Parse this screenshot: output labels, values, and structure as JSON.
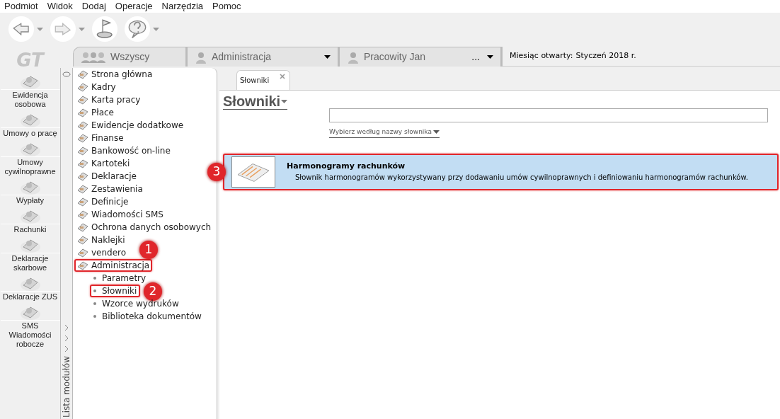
{
  "menu": [
    "Podmiot",
    "Widok",
    "Dodaj",
    "Operacje",
    "Narzędzia",
    "Pomoc"
  ],
  "toolbar": [
    {
      "kind": "back",
      "has_caret": true
    },
    {
      "kind": "forward",
      "has_caret": true
    },
    {
      "kind": "flag",
      "has_caret": false
    },
    {
      "kind": "help",
      "has_caret": true
    }
  ],
  "logo": "GT",
  "top_tabs": [
    {
      "label": "Wszyscy",
      "kind": "group"
    },
    {
      "label": "Administracja",
      "kind": "dropdown"
    },
    {
      "label": "Pracowity Jan",
      "kind": "person",
      "extra": "..."
    }
  ],
  "open_month": {
    "label": "Miesiąc otwarty:",
    "value": "Styczeń 2018 r."
  },
  "modules": [
    {
      "label": "Ewidencja osobowa"
    },
    {
      "label": "Umowy o pracę"
    },
    {
      "label": "Umowy cywilnoprawne"
    },
    {
      "label": "Wypłaty"
    },
    {
      "label": "Rachunki"
    },
    {
      "label": "Deklaracje skarbowe"
    },
    {
      "label": "Deklaracje ZUS"
    },
    {
      "label": "SMS Wiadomości robocze"
    }
  ],
  "module_strip": {
    "label": "Lista modułów"
  },
  "tree": [
    {
      "label": "Strona główna",
      "highlighted": false
    },
    {
      "label": "Kadry",
      "highlighted": false
    },
    {
      "label": "Karta pracy",
      "highlighted": false
    },
    {
      "label": "Płace",
      "highlighted": false
    },
    {
      "label": "Ewidencje dodatkowe",
      "highlighted": false
    },
    {
      "label": "Finanse",
      "highlighted": false
    },
    {
      "label": "Bankowość on-line",
      "highlighted": false
    },
    {
      "label": "Kartoteki",
      "highlighted": false
    },
    {
      "label": "Deklaracje",
      "highlighted": false
    },
    {
      "label": "Zestawienia",
      "highlighted": false
    },
    {
      "label": "Definicje",
      "highlighted": false
    },
    {
      "label": "Wiadomości SMS",
      "highlighted": false
    },
    {
      "label": "Ochrona danych osobowych",
      "highlighted": false
    },
    {
      "label": "Naklejki",
      "highlighted": false
    },
    {
      "label": "vendero",
      "highlighted": false
    },
    {
      "label": "Administracja",
      "highlighted": true,
      "expanded": true,
      "badge": "1",
      "children": [
        {
          "label": "Parametry",
          "highlighted": false
        },
        {
          "label": "Słowniki",
          "highlighted": true,
          "badge": "2"
        },
        {
          "label": "Wzorce wydruków",
          "highlighted": false
        },
        {
          "label": "Biblioteka dokumentów",
          "highlighted": false
        }
      ]
    }
  ],
  "doc_tab": {
    "label": "Słowniki",
    "selected": true
  },
  "heading": "Słowniki",
  "filter": {
    "link": "Wybierz według nazwy słownika"
  },
  "results": [
    {
      "title": "Harmonogramy rachunków",
      "description": "Słownik harmonogramów wykorzystywany przy dodawaniu umów cywilnoprawnych i definiowaniu harmonogramów rachunków.",
      "selected": true,
      "highlighted": true,
      "badge": "3"
    }
  ]
}
